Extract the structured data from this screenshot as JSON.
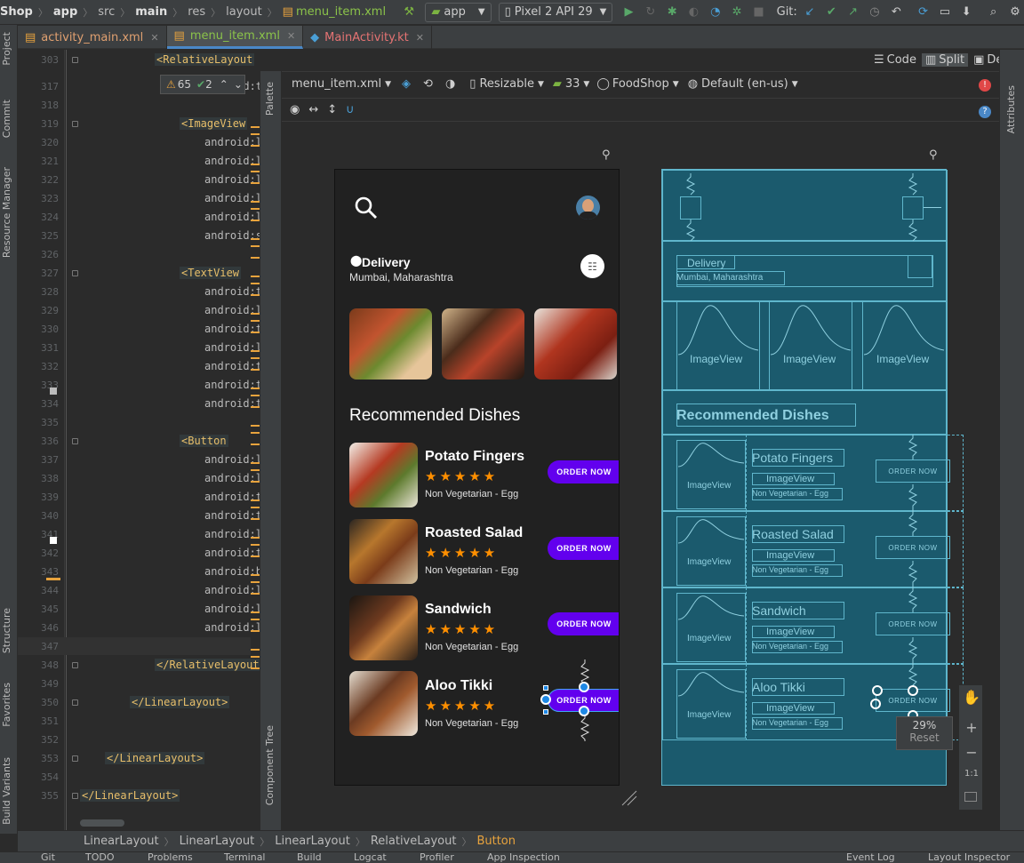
{
  "breadcrumb": [
    "Shop",
    "app",
    "src",
    "main",
    "res",
    "layout",
    "menu_item.xml"
  ],
  "toolbar": {
    "run_config": "app",
    "device": "Pixel 2 API 29",
    "git_label": "Git:"
  },
  "tabs": [
    {
      "label": "activity_main.xml",
      "active": false
    },
    {
      "label": "menu_item.xml",
      "active": true
    },
    {
      "label": "MainActivity.kt",
      "active": false
    }
  ],
  "left_tools": [
    "Project",
    "Commit",
    "Resource Manager",
    "Structure",
    "Favorites",
    "Build Variants"
  ],
  "view_modes": {
    "code": "Code",
    "split": "Split",
    "design": "Design"
  },
  "inspection": {
    "warnings": "65",
    "checks": "2"
  },
  "design_toolbar": {
    "file": "menu_item.xml",
    "resize": "Resizable",
    "api": "33",
    "theme": "FoodShop",
    "locale": "Default (en-us)"
  },
  "palette_label": "Palette",
  "component_tree_label": "Component Tree",
  "attributes_label": "Attributes",
  "code_lines": [
    {
      "n": "303",
      "text": "<RelativeLayout",
      "indent": 100,
      "kind": "tag"
    },
    {
      "n": "317",
      "text": "android:t",
      "indent": 156,
      "kind": "attr"
    },
    {
      "n": "318",
      "text": "",
      "indent": 0,
      "kind": "attr"
    },
    {
      "n": "319",
      "text": "<ImageView",
      "indent": 128,
      "kind": "tag"
    },
    {
      "n": "320",
      "text": "android:l",
      "indent": 156,
      "kind": "attr"
    },
    {
      "n": "321",
      "text": "android:l",
      "indent": 156,
      "kind": "attr"
    },
    {
      "n": "322",
      "text": "android:l",
      "indent": 156,
      "kind": "attr"
    },
    {
      "n": "323",
      "text": "android:l",
      "indent": 156,
      "kind": "attr"
    },
    {
      "n": "324",
      "text": "android:l",
      "indent": 156,
      "kind": "attr"
    },
    {
      "n": "325",
      "text": "android:s",
      "indent": 156,
      "kind": "attr"
    },
    {
      "n": "326",
      "text": "",
      "indent": 0,
      "kind": "attr"
    },
    {
      "n": "327",
      "text": "<TextView",
      "indent": 128,
      "kind": "tag"
    },
    {
      "n": "328",
      "text": "android:t",
      "indent": 156,
      "kind": "attr"
    },
    {
      "n": "329",
      "text": "android:l",
      "indent": 156,
      "kind": "attr"
    },
    {
      "n": "330",
      "text": "android:t",
      "indent": 156,
      "kind": "attr"
    },
    {
      "n": "331",
      "text": "android:l",
      "indent": 156,
      "kind": "attr"
    },
    {
      "n": "332",
      "text": "android:t",
      "indent": 156,
      "kind": "attr"
    },
    {
      "n": "333",
      "text": "android:t",
      "indent": 156,
      "kind": "attr"
    },
    {
      "n": "334",
      "text": "android:t",
      "indent": 156,
      "kind": "attr"
    },
    {
      "n": "335",
      "text": "",
      "indent": 0,
      "kind": "attr"
    },
    {
      "n": "336",
      "text": "<Button",
      "indent": 128,
      "kind": "tag"
    },
    {
      "n": "337",
      "text": "android:l",
      "indent": 156,
      "kind": "attr"
    },
    {
      "n": "338",
      "text": "android:l",
      "indent": 156,
      "kind": "attr"
    },
    {
      "n": "339",
      "text": "android:t",
      "indent": 156,
      "kind": "attr"
    },
    {
      "n": "340",
      "text": "android:t",
      "indent": 156,
      "kind": "attr"
    },
    {
      "n": "341",
      "text": "android:l",
      "indent": 156,
      "kind": "attr"
    },
    {
      "n": "342",
      "text": "android:t",
      "indent": 156,
      "kind": "attr"
    },
    {
      "n": "343",
      "text": "android:b",
      "indent": 156,
      "kind": "attr"
    },
    {
      "n": "344",
      "text": "android:l",
      "indent": 156,
      "kind": "attr"
    },
    {
      "n": "345",
      "text": "android:l",
      "indent": 156,
      "kind": "attr"
    },
    {
      "n": "346",
      "text": "android:l",
      "indent": 156,
      "kind": "attr"
    },
    {
      "n": "347",
      "text": "",
      "indent": 0,
      "kind": "attr"
    },
    {
      "n": "348",
      "text": "</RelativeLayout>",
      "indent": 100,
      "kind": "tag"
    },
    {
      "n": "349",
      "text": "",
      "indent": 0,
      "kind": "attr"
    },
    {
      "n": "350",
      "text": "</LinearLayout>",
      "indent": 72,
      "kind": "tag"
    },
    {
      "n": "351",
      "text": "",
      "indent": 0,
      "kind": "attr"
    },
    {
      "n": "352",
      "text": "",
      "indent": 0,
      "kind": "attr"
    },
    {
      "n": "353",
      "text": "</LinearLayout>",
      "indent": 44,
      "kind": "tag"
    },
    {
      "n": "354",
      "text": "",
      "indent": 0,
      "kind": "attr"
    },
    {
      "n": "355",
      "text": "</LinearLayout>",
      "indent": 16,
      "kind": "tag"
    }
  ],
  "app": {
    "delivery_title": "Delivery",
    "delivery_location": "Mumbai, Maharashtra",
    "section_title": "Recommended Dishes",
    "order_label": "ORDER NOW",
    "rating_stars": "★★★★★",
    "dishes": [
      {
        "name": "Potato Fingers",
        "subtitle": "Non Vegetarian - Egg"
      },
      {
        "name": "Roasted Salad",
        "subtitle": "Non Vegetarian - Egg"
      },
      {
        "name": "Sandwich",
        "subtitle": "Non Vegetarian - Egg"
      },
      {
        "name": "Aloo Tikki",
        "subtitle": "Non Vegetarian - Egg"
      }
    ]
  },
  "blueprint": {
    "imageview_label": "ImageView"
  },
  "zoom": {
    "level": "29%",
    "reset": "Reset",
    "one_to_one": "1:1"
  },
  "bottom_breadcrumb": [
    "LinearLayout",
    "LinearLayout",
    "LinearLayout",
    "RelativeLayout",
    "Button"
  ],
  "status_items": [
    "Git",
    "TODO",
    "Problems",
    "Terminal",
    "Build",
    "Logcat",
    "Profiler",
    "App Inspection",
    "Event Log",
    "Layout Inspector"
  ],
  "colors": {
    "accent": "#6200ee",
    "star": "#ff8f00",
    "blueprint": "#1b5a6d",
    "tag": "#e8bf6a"
  }
}
